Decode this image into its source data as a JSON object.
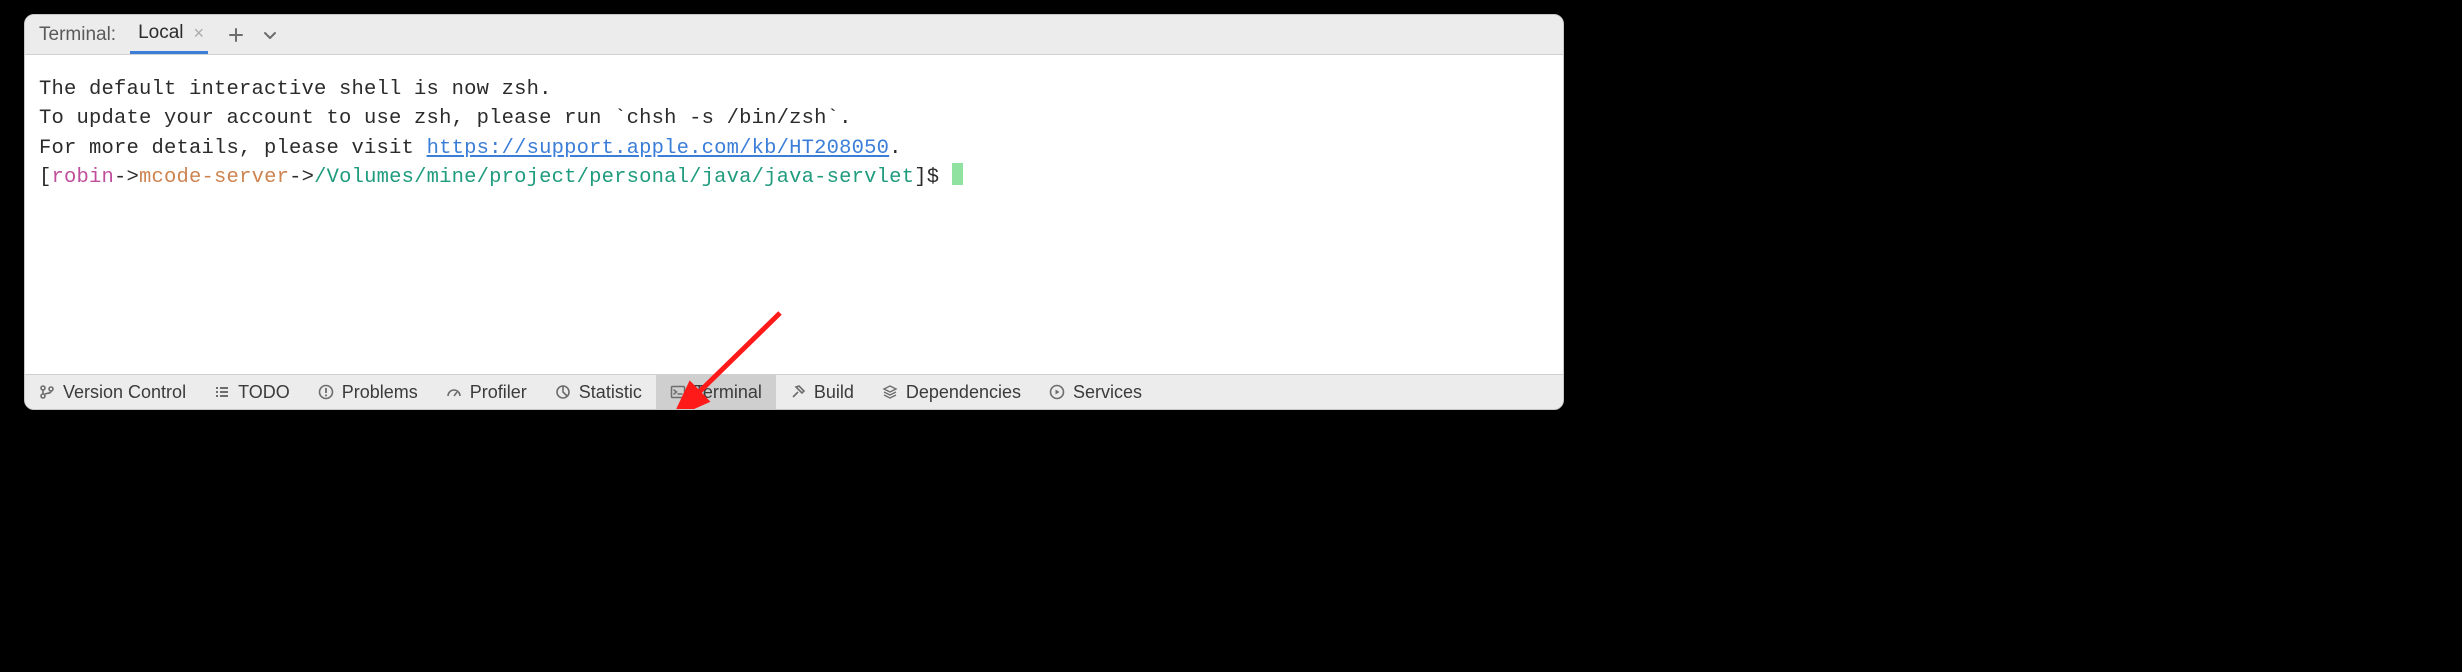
{
  "header": {
    "panel_label": "Terminal:",
    "active_tab": "Local"
  },
  "terminal": {
    "line1": "The default interactive shell is now zsh.",
    "line2": "To update your account to use zsh, please run `chsh -s /bin/zsh`.",
    "line3a": "For more details, please visit ",
    "link": "https://support.apple.com/kb/HT208050",
    "line3b": ".",
    "prompt": {
      "open": "[",
      "user": "robin",
      "arrow1": "->",
      "host": "mcode-server",
      "arrow2": "->",
      "path": "/Volumes/mine/project/personal/java/java-servlet",
      "close": "]$ "
    }
  },
  "bottom_tabs": {
    "vcs": "Version Control",
    "todo": "TODO",
    "problems": "Problems",
    "profiler": "Profiler",
    "statistic": "Statistic",
    "terminal": "Terminal",
    "build": "Build",
    "dependencies": "Dependencies",
    "services": "Services"
  }
}
